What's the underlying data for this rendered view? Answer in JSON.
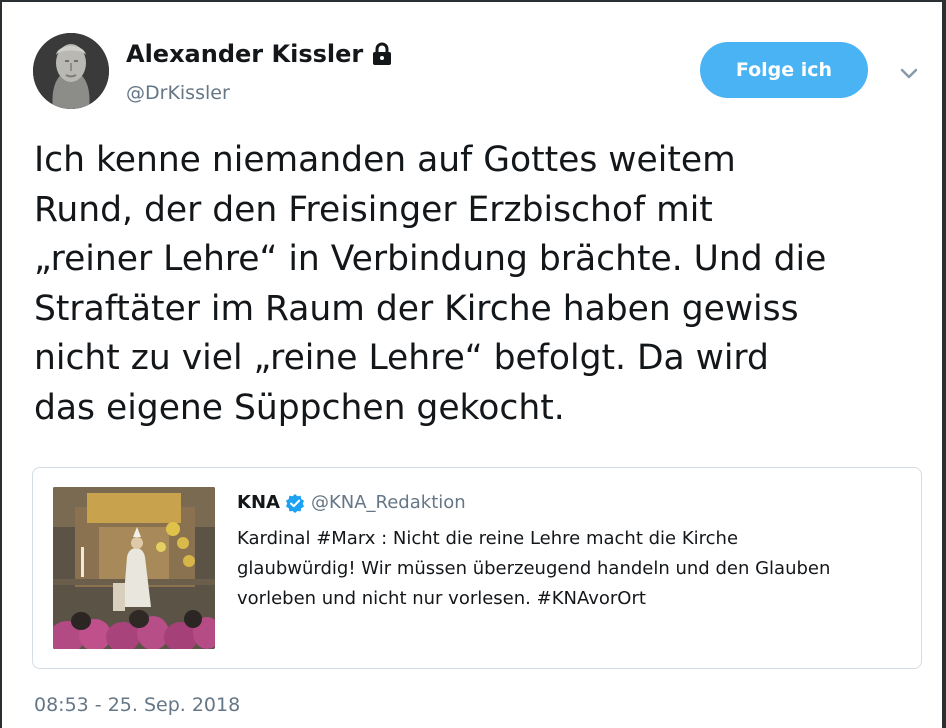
{
  "author": {
    "display_name": "Alexander Kissler",
    "handle": "@DrKissler",
    "protected_icon": "lock-icon",
    "avatar_icon": "avatar-statue-portrait"
  },
  "actions": {
    "follow_label": "Folge ich",
    "menu_icon": "chevron-down-icon"
  },
  "tweet": {
    "text_lines": [
      "Ich kenne niemanden auf Gottes weitem",
      "Rund, der den Freisinger Erzbischof mit",
      "„reiner Lehre“ in Verbindung brächte. Und die",
      "Straftäter im Raum der Kirche haben gewiss",
      "nicht zu viel „reine Lehre“ befolgt. Da wird",
      "das eigene Süppchen gekocht."
    ],
    "timestamp": "08:53 - 25. Sep. 2018"
  },
  "quoted_tweet": {
    "name": "KNA",
    "verified_icon": "verified-badge-icon",
    "handle": "@KNA_Redaktion",
    "text_lines": [
      "Kardinal #Marx : Nicht die reine Lehre macht die Kirche",
      "glaubwürdig! Wir müssen überzeugend handeln und den Glauben",
      "vorleben und nicht nur vorlesen. #KNAvorOrt"
    ],
    "image_icon": "church-altar-photo"
  },
  "colors": {
    "accent": "#4ab3f4",
    "text": "#14171a",
    "muted": "#657786",
    "border": "#d5dde3",
    "frame": "#2a2f33"
  }
}
